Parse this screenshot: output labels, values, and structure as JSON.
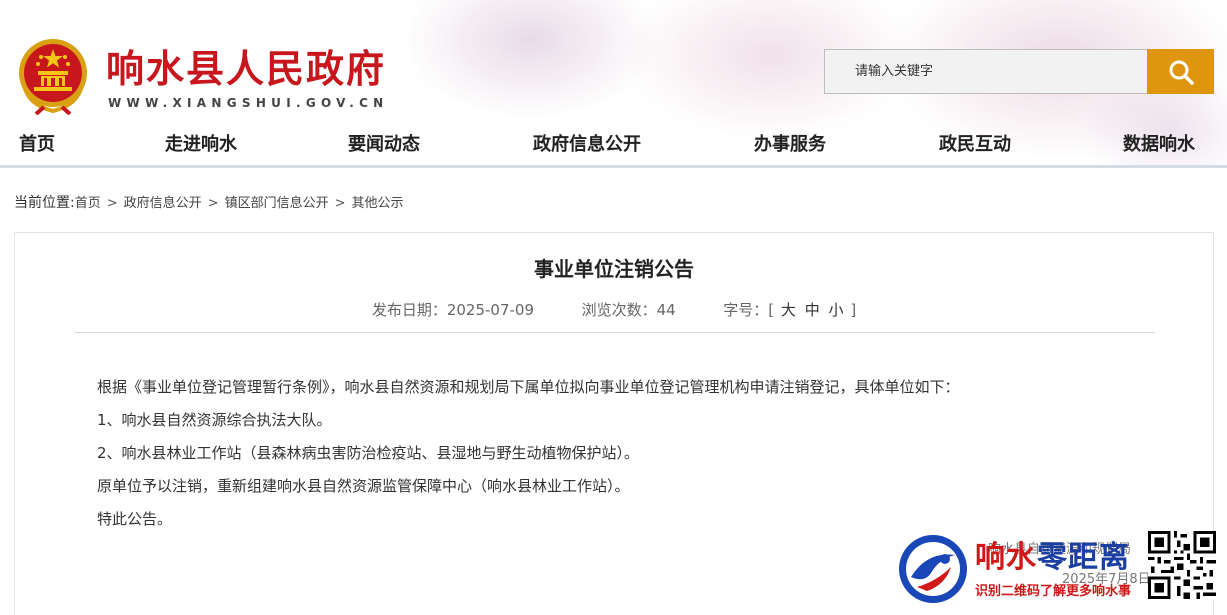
{
  "header": {
    "title": "响水县人民政府",
    "url": "WWW.XIANGSHUI.GOV.CN",
    "search_placeholder": "请输入关键字"
  },
  "nav": [
    {
      "label": "首页"
    },
    {
      "label": "走进响水"
    },
    {
      "label": "要闻动态"
    },
    {
      "label": "政府信息公开"
    },
    {
      "label": "办事服务"
    },
    {
      "label": "政民互动"
    },
    {
      "label": "数据响水"
    }
  ],
  "breadcrumb": {
    "lead": "当前位置:",
    "items": [
      "首页",
      "政府信息公开",
      "镇区部门信息公开",
      "其他公示"
    ],
    "separator": ">"
  },
  "article": {
    "title": "事业单位注销公告",
    "publish_label": "发布日期：",
    "publish_date": "2025-07-09",
    "views_label": "浏览次数：",
    "views": "44",
    "font_label": "字号：",
    "font_open": "[",
    "font_large": "大",
    "font_medium": "中",
    "font_small": "小",
    "font_close": "]",
    "paragraphs": [
      "根据《事业单位登记管理暂行条例》，响水县自然资源和规划局下属单位拟向事业单位登记管理机构申请注销登记，具体单位如下：",
      "1、响水县自然资源综合执法大队。",
      "2、响水县林业工作站（县森林病虫害防治检疫站、县湿地与野生动植物保护站）。",
      "原单位予以注销，重新组建响水县自然资源监管保障中心（响水县林业工作站）。",
      "特此公告。"
    ],
    "signature_org": "响水县自然资源和规划局",
    "signature_date": "2025年7月8日"
  },
  "watermark": {
    "title_red": "响水",
    "title_blue": "零距离",
    "subtitle": "识别二维码了解更多响水事"
  },
  "colors": {
    "title_red": "#c8161d",
    "search_button": "#e0950f",
    "nav_bar": "#d3dbe5"
  }
}
